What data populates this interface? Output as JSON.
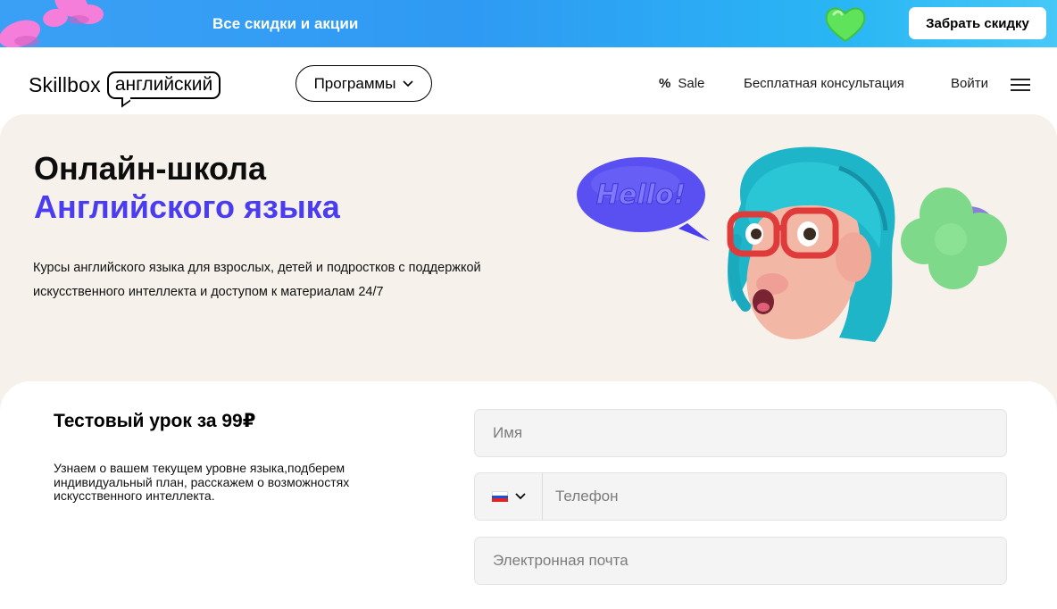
{
  "promo": {
    "text": "Все скидки и акции",
    "button_label": "Забрать скидку"
  },
  "header": {
    "logo_word": "Skillbox",
    "logo_tag": "английский",
    "programs_label": "Программы",
    "nav": {
      "sale_icon": "%",
      "sale_label": "Sale",
      "consult_label": "Бесплатная консультация",
      "login_label": "Войти"
    }
  },
  "hero": {
    "title_line1": "Онлайн-школа",
    "title_line2": "Английского языка",
    "description": "Курсы английского языка для взрослых, детей и подростков с поддержкой искусственного интеллекта и доступом к материалам 24/7",
    "bubble_text": "Hello!"
  },
  "lesson": {
    "title": "Тестовый урок за 99₽",
    "description": "Узнаем о вашем текущем уровне языка,подберем индивидуальный план, расскажем о возможностях искусственного интеллекта.",
    "fields": {
      "name_placeholder": "Имя",
      "phone_placeholder": "Телефон",
      "email_placeholder": "Электронная почта",
      "country": "ru"
    }
  },
  "colors": {
    "accent": "#4a3df0",
    "banner": "#3aa0f5",
    "hero_bg": "#f6f1ea"
  }
}
